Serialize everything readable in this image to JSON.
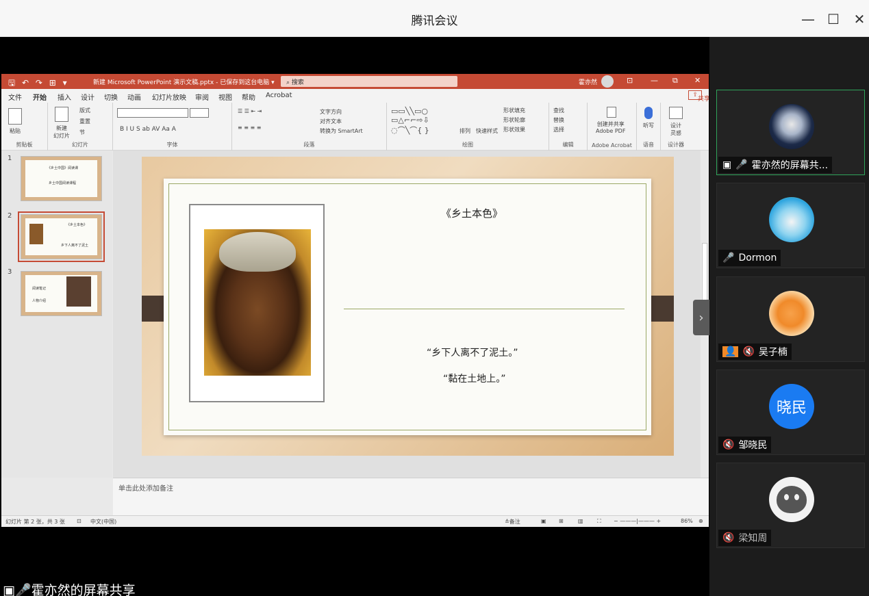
{
  "window": {
    "title": "腾讯会议",
    "minimize": "—",
    "maximize": "☐",
    "close": "✕"
  },
  "ppt": {
    "quick_access": "🖫 ↶ ↷ ⊞ ▾",
    "filename": "新建 Microsoft PowerPoint 演示文稿.pptx - 已保存到这台电脑 ▾",
    "search": "搜索",
    "user": "霍亦然",
    "menu": [
      "文件",
      "开始",
      "插入",
      "设计",
      "切换",
      "动画",
      "幻灯片放映",
      "审阅",
      "视图",
      "帮助",
      "Acrobat"
    ],
    "share_btn": "共享",
    "ribbon": {
      "clipboard": {
        "label": "剪贴板",
        "paste": "粘贴"
      },
      "slides": {
        "label": "幻灯片",
        "new": "新建\n幻灯片",
        "layout": "版式",
        "reset": "重置",
        "section": "节"
      },
      "font": {
        "label": "字体",
        "tools": "B  I  U  S  ab  AV  Aa  A"
      },
      "paragraph": {
        "label": "段落",
        "text_dir": "文字方向",
        "align_text": "对齐文本",
        "smartart": "转换为 SmartArt"
      },
      "drawing": {
        "label": "绘图",
        "arrange": "排列",
        "quick_styles": "快速样式",
        "fill": "形状填充",
        "outline": "形状轮廓",
        "effects": "形状效果"
      },
      "editing": {
        "label": "编辑",
        "find": "查找",
        "replace": "替换",
        "select": "选择"
      },
      "acrobat": {
        "label": "Adobe Acrobat",
        "create": "创建并共享\nAdobe PDF"
      },
      "voice": {
        "label": "语音",
        "dictate": "听写"
      },
      "designer": {
        "label": "设计器",
        "design_ideas": "设计\n灵感"
      }
    },
    "thumbs": [
      {
        "num": "1",
        "title": "《乡土中国》阅读课",
        "sub": "乡土中国阅读课程"
      },
      {
        "num": "2",
        "title": "《乡土本色》",
        "sub": "乡下人离不了泥土"
      },
      {
        "num": "3",
        "title": "阅读笔记",
        "sub": "人物介绍"
      }
    ],
    "slide": {
      "title": "《乡土本色》",
      "quote1": "“乡下人离不了泥土。”",
      "quote2": "“黏在土地上。”"
    },
    "notes": "单击此处添加备注",
    "status": {
      "slide_info": "幻灯片 第 2 张，共 3 张",
      "lang": "中文(中国)",
      "notes_btn": "≙备注",
      "zoom": "86%"
    }
  },
  "share_label": "霍亦然的屏幕共享",
  "participants": [
    {
      "name": "霍亦然的屏幕共...",
      "mic": "on",
      "sharing": true,
      "avatar": "astronaut"
    },
    {
      "name": "Dormon",
      "mic": "white",
      "sharing": false,
      "avatar": "cartoon-blue"
    },
    {
      "name": "吴子楠",
      "mic": "muted",
      "sharing": false,
      "avatar": "cartoon-orange"
    },
    {
      "name": "邹晓民",
      "mic": "muted",
      "sharing": false,
      "avatar": "晓民",
      "avatar_color": "#1a7bf2"
    },
    {
      "name": "梁知周",
      "mic": "muted-gray",
      "sharing": false,
      "avatar": "default"
    }
  ],
  "colors": {
    "ppt_accent": "#c54a34",
    "active_tile": "#2fa55a",
    "mic_green": "#35c04b"
  }
}
